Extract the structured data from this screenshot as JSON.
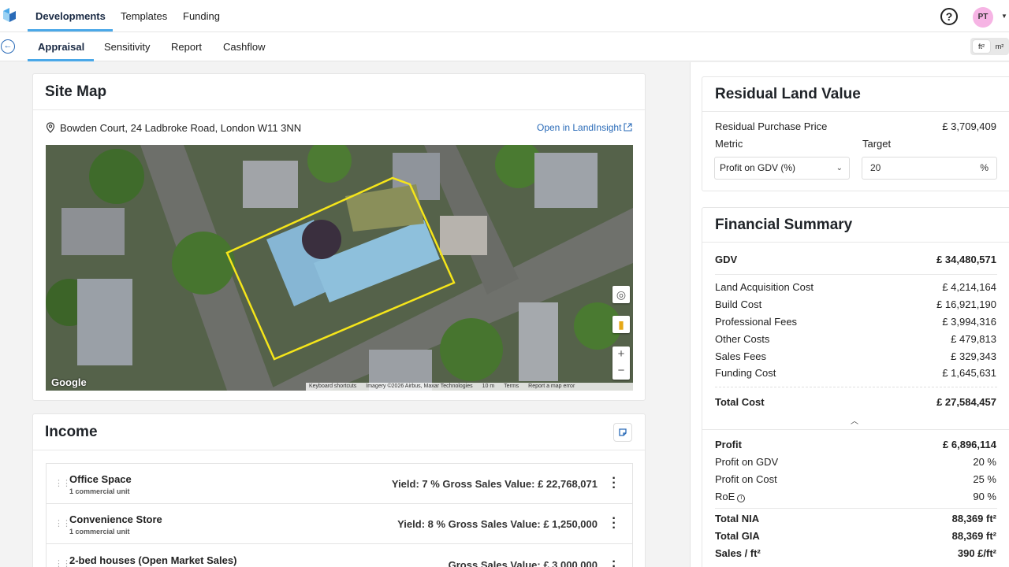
{
  "topnav": {
    "tabs": [
      "Developments",
      "Templates",
      "Funding"
    ],
    "help_icon": "question-circle-icon",
    "avatar_initials": "PT"
  },
  "subnav": {
    "tabs": [
      "Appraisal",
      "Sensitivity",
      "Report",
      "Cashflow"
    ],
    "units": [
      "ft²",
      "m²"
    ]
  },
  "site_map": {
    "title": "Site Map",
    "address": "Bowden Court, 24 Ladbroke Road, London W11 3NN",
    "open_link": "Open in LandInsight",
    "google": "Google",
    "attribution": [
      "Keyboard shortcuts",
      "Imagery ©2026 Airbus, Maxar Technologies",
      "10 m",
      "Terms",
      "Report a map error"
    ]
  },
  "income": {
    "title": "Income",
    "rows": [
      {
        "name": "Office Space",
        "sub": "1 commercial unit",
        "value": "Yield: 7 %  Gross Sales Value: £ 22,768,071"
      },
      {
        "name": "Convenience Store",
        "sub": "1 commercial unit",
        "value": "Yield: 8 %  Gross Sales Value: £ 1,250,000"
      },
      {
        "name": "2-bed houses (Open Market Sales)",
        "sub": "",
        "value": "Gross Sales Value: £ 3,000,000"
      }
    ]
  },
  "rlv": {
    "title": "Residual Land Value",
    "purchase_label": "Residual Purchase Price",
    "purchase_value": "£ 3,709,409",
    "metric_label": "Metric",
    "target_label": "Target",
    "metric_value": "Profit on GDV (%)",
    "target_value": "20",
    "target_unit": "%"
  },
  "summary": {
    "title": "Financial Summary",
    "gdv_label": "GDV",
    "gdv_value": "£ 34,480,571",
    "costs": [
      {
        "label": "Land Acquisition Cost",
        "value": "£ 4,214,164"
      },
      {
        "label": "Build Cost",
        "value": "£ 16,921,190"
      },
      {
        "label": "Professional Fees",
        "value": "£ 3,994,316"
      },
      {
        "label": "Other Costs",
        "value": "£ 479,813"
      },
      {
        "label": "Sales Fees",
        "value": "£ 329,343"
      },
      {
        "label": "Funding Cost",
        "value": "£ 1,645,631"
      }
    ],
    "total_cost_label": "Total Cost",
    "total_cost_value": "£ 27,584,457",
    "profit_label": "Profit",
    "profit_value": "£ 6,896,114",
    "profit_gdv_label": "Profit on GDV",
    "profit_gdv_value": "20 %",
    "profit_cost_label": "Profit on Cost",
    "profit_cost_value": "25 %",
    "roe_label": "RoE",
    "roe_value": "90 %",
    "nia_label": "Total NIA",
    "nia_value": "88,369 ft²",
    "gia_label": "Total GIA",
    "gia_value": "88,369 ft²",
    "sales_label": "Sales / ft²",
    "sales_value": "390 £/ft²"
  }
}
